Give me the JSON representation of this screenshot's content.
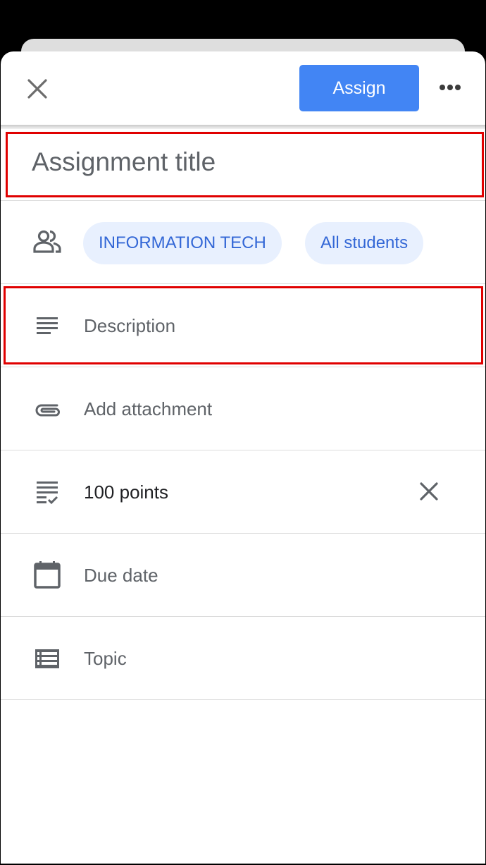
{
  "header": {
    "assign_label": "Assign",
    "close_icon": "close-icon",
    "more_icon": "more-horizontal-icon"
  },
  "form": {
    "title_placeholder": "Assignment title",
    "recipients": {
      "icon": "people-icon",
      "class_chip": "INFORMATION TECH",
      "students_chip": "All students"
    },
    "description_placeholder": "Description",
    "attachment_label": "Add attachment",
    "points_label": "100 points",
    "due_date_label": "Due date",
    "topic_label": "Topic"
  },
  "colors": {
    "accent": "#4285f4",
    "chip_bg": "#e8f0fe",
    "chip_text": "#3367d6",
    "highlight": "#e00000"
  }
}
